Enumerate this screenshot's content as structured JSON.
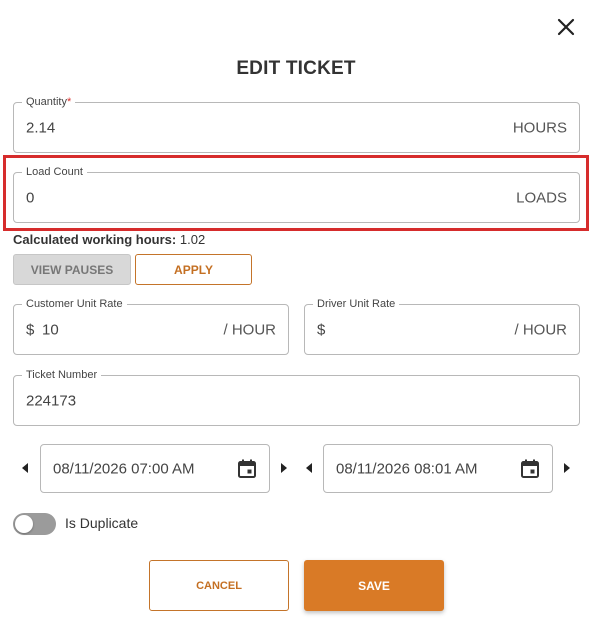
{
  "dialog": {
    "title": "EDIT TICKET"
  },
  "quantity": {
    "label": "Quantity",
    "required_marker": "*",
    "value": "2.14",
    "unit": "HOURS"
  },
  "load_count": {
    "label": "Load Count",
    "value": "0",
    "unit": "LOADS",
    "highlight_color": "#d62c2c"
  },
  "calculated": {
    "label": "Calculated working hours:",
    "value": "1.02"
  },
  "buttons": {
    "view_pauses": "VIEW PAUSES",
    "apply": "APPLY",
    "cancel": "CANCEL",
    "save": "SAVE"
  },
  "customer_rate": {
    "label": "Customer Unit Rate",
    "currency": "$",
    "value": "10",
    "unit": "/ HOUR"
  },
  "driver_rate": {
    "label": "Driver Unit Rate",
    "currency": "$",
    "value": "",
    "unit": "/ HOUR"
  },
  "ticket_number": {
    "label": "Ticket Number",
    "value": "224173"
  },
  "start_datetime": {
    "value": "08/11/2026 07:00 AM"
  },
  "end_datetime": {
    "value": "08/11/2026 08:01 AM"
  },
  "duplicate": {
    "label": "Is Duplicate",
    "checked": false
  },
  "colors": {
    "accent": "#d97a26",
    "accent_text": "#c46f22",
    "toggle_off": "#9b9b9b"
  },
  "icons": {
    "close": "close-icon",
    "calendar": "calendar-icon",
    "prev": "caret-left-icon",
    "next": "caret-right-icon"
  }
}
